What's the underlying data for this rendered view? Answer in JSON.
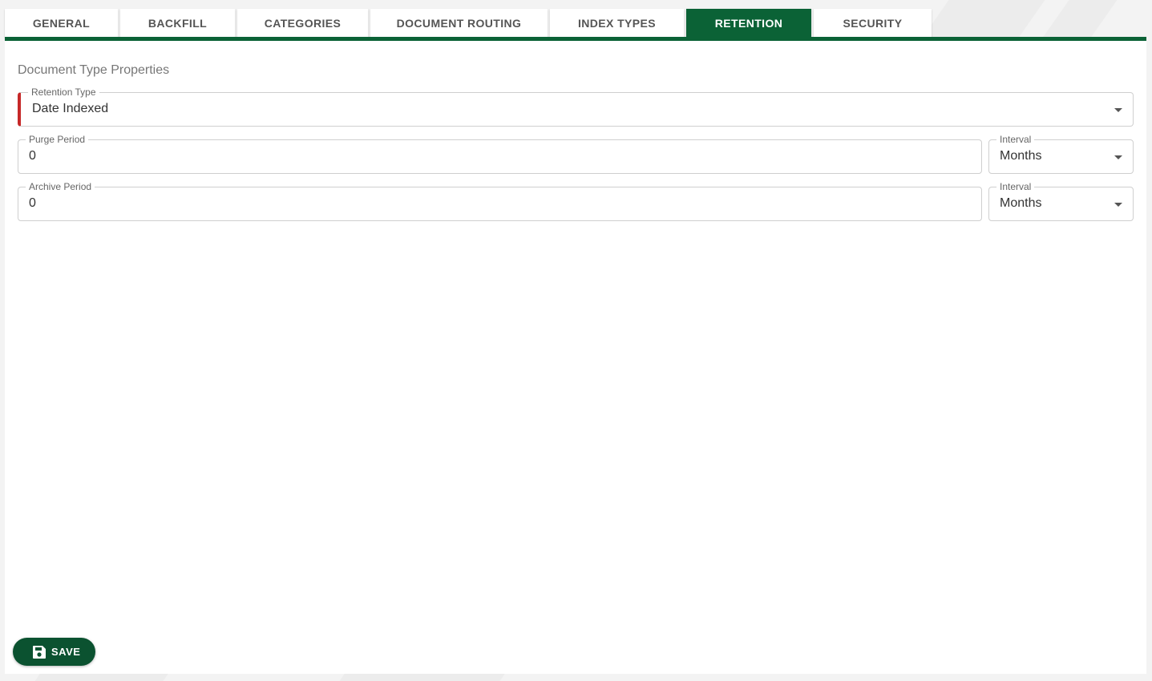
{
  "tabs": [
    {
      "label": "GENERAL",
      "active": false
    },
    {
      "label": "BACKFILL",
      "active": false
    },
    {
      "label": "CATEGORIES",
      "active": false
    },
    {
      "label": "DOCUMENT ROUTING",
      "active": false
    },
    {
      "label": "INDEX TYPES",
      "active": false
    },
    {
      "label": "RETENTION",
      "active": true
    },
    {
      "label": "SECURITY",
      "active": false
    }
  ],
  "form": {
    "section_title": "Document Type Properties",
    "retention_type": {
      "label": "Retention Type",
      "value": "Date Indexed",
      "required": true
    },
    "purge_period": {
      "label": "Purge Period",
      "value": "0"
    },
    "purge_interval": {
      "label": "Interval",
      "value": "Months"
    },
    "archive_period": {
      "label": "Archive Period",
      "value": "0"
    },
    "archive_interval": {
      "label": "Interval",
      "value": "Months"
    }
  },
  "actions": {
    "save_label": "SAVE",
    "save_icon": "floppy-disk-icon"
  },
  "colors": {
    "accent": "#0b6236",
    "save_button": "#0b5230",
    "required_marker": "#c62828"
  }
}
